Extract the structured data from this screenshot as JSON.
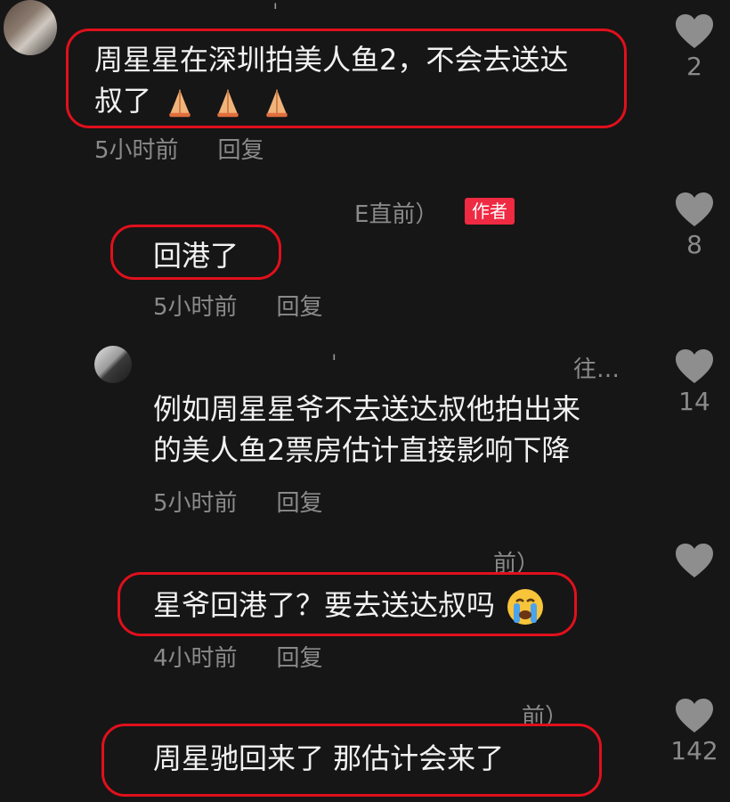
{
  "comments": [
    {
      "text_line1": "周星星在深圳拍美人鱼2，不会去送达",
      "text_line2": "叔了",
      "time": "5小时前",
      "reply": "回复",
      "likes": "2",
      "emoji": "folded-hands"
    },
    {
      "nick_fragment": "E直前）",
      "badge": "作者",
      "text": "回港了",
      "time": "5小时前",
      "reply": "回复",
      "likes": "8"
    },
    {
      "nick_fragment": "往…",
      "text_line1": "例如周星星爷不去送达叔他拍出来",
      "text_line2": "的美人鱼2票房估计直接影响下降",
      "time": "5小时前",
      "reply": "回复",
      "likes": "14"
    },
    {
      "nick_fragment": "前）",
      "text": "星爷回港了？要去送达叔吗",
      "time": "4小时前",
      "reply": "回复",
      "likes": "",
      "emoji": "crying-face"
    },
    {
      "nick_fragment": "前）",
      "text": "周星驰回来了 那估计会来了",
      "likes": "142"
    }
  ],
  "colors": {
    "background": "#161616",
    "highlight": "#e0101c",
    "author_badge": "#ef2a43",
    "muted": "#8a8a8a"
  }
}
